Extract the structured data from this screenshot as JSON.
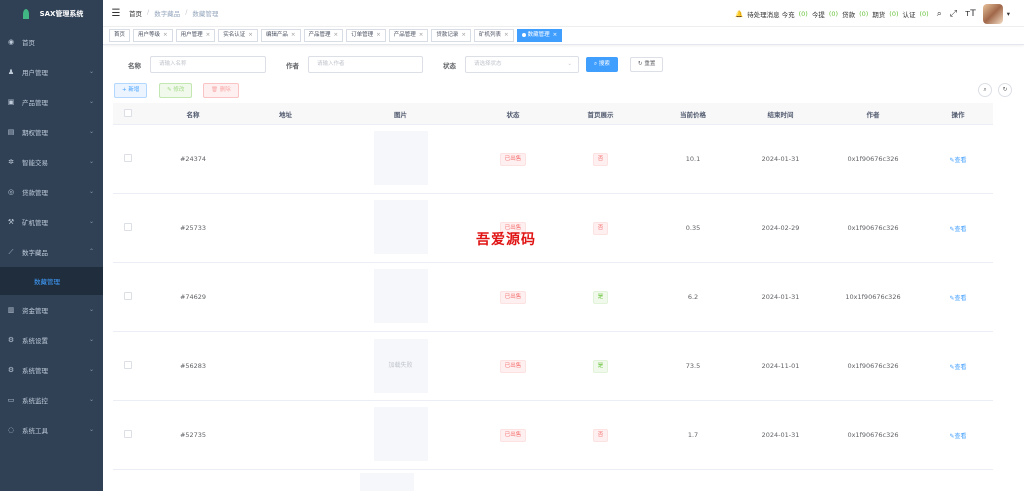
{
  "sidebar": {
    "logo": "SAX管理系统",
    "items": [
      {
        "label": "首页",
        "icon": "dashboard-icon",
        "glyph": "◉",
        "chevron": ""
      },
      {
        "label": "用户管理",
        "icon": "user-icon",
        "glyph": "♟",
        "chevron": "⌄"
      },
      {
        "label": "产品管理",
        "icon": "product-icon",
        "glyph": "▣",
        "chevron": "⌄"
      },
      {
        "label": "期权管理",
        "icon": "options-icon",
        "glyph": "▤",
        "chevron": "⌄"
      },
      {
        "label": "智能交易",
        "icon": "trade-icon",
        "glyph": "✲",
        "chevron": "⌄"
      },
      {
        "label": "贷款管理",
        "icon": "loan-icon",
        "glyph": "◎",
        "chevron": "⌄"
      },
      {
        "label": "矿机管理",
        "icon": "miner-icon",
        "glyph": "⚒",
        "chevron": "⌄"
      },
      {
        "label": "数字藏品",
        "icon": "nft-icon",
        "glyph": "⟋",
        "chevron": "⌃"
      },
      {
        "label": "数藏管理",
        "icon": "",
        "glyph": "",
        "chevron": ""
      },
      {
        "label": "资金管理",
        "icon": "funds-icon",
        "glyph": "▥",
        "chevron": "⌄"
      },
      {
        "label": "系统设置",
        "icon": "settings-icon",
        "glyph": "⚙",
        "chevron": "⌄"
      },
      {
        "label": "系统管理",
        "icon": "system-icon",
        "glyph": "⚙",
        "chevron": "⌄"
      },
      {
        "label": "系统监控",
        "icon": "monitor-icon",
        "glyph": "▭",
        "chevron": "⌄"
      },
      {
        "label": "系统工具",
        "icon": "tools-icon",
        "glyph": "◌",
        "chevron": "⌄"
      }
    ]
  },
  "navbar": {
    "breadcrumb": [
      "首页",
      "数字藏品",
      "数藏管理"
    ],
    "pending_label": "待处理消息 今充",
    "recharge_count": "(0)",
    "withdraw_label": "今提",
    "withdraw_count": "(0)",
    "loan_label": "贷款",
    "loan_count": "(0)",
    "futures_label": "期货",
    "futures_count": "(0)",
    "kyc_label": "认证",
    "kyc_count": "(0)"
  },
  "tags": [
    {
      "label": "首页",
      "active": false,
      "closable": false
    },
    {
      "label": "用户等级",
      "active": false,
      "closable": true
    },
    {
      "label": "用户管理",
      "active": false,
      "closable": true
    },
    {
      "label": "实名认证",
      "active": false,
      "closable": true
    },
    {
      "label": "编辑产品",
      "active": false,
      "closable": true
    },
    {
      "label": "产品管理",
      "active": false,
      "closable": true
    },
    {
      "label": "订单管理",
      "active": false,
      "closable": true
    },
    {
      "label": "产品管理",
      "active": false,
      "closable": true
    },
    {
      "label": "贷款记录",
      "active": false,
      "closable": true
    },
    {
      "label": "矿机列表",
      "active": false,
      "closable": true
    },
    {
      "label": "数藏管理",
      "active": true,
      "closable": true
    }
  ],
  "search": {
    "name_label": "名称",
    "name_placeholder": "请输入名称",
    "author_label": "作者",
    "author_placeholder": "请输入作者",
    "status_label": "状态",
    "status_placeholder": "请选择状态",
    "search_button": "搜索",
    "reset_button": "重置"
  },
  "toolbar": {
    "add": "新增",
    "edit": "修改",
    "delete": "删除"
  },
  "table": {
    "headers": [
      "名称",
      "地址",
      "图片",
      "状态",
      "首页展示",
      "当前价格",
      "结束时间",
      "作者",
      "操作"
    ],
    "rows": [
      {
        "name": "#24374",
        "address": "",
        "image": "",
        "status": "已出售",
        "home": "否",
        "home_color": "red",
        "price": "10.1",
        "end": "2024-01-31",
        "author": "0x1f90676c326",
        "action": "查看"
      },
      {
        "name": "#25733",
        "address": "",
        "image": "",
        "status": "已出售",
        "home": "否",
        "home_color": "red",
        "price": "0.35",
        "end": "2024-02-29",
        "author": "0x1f90676c326",
        "action": "查看"
      },
      {
        "name": "#74629",
        "address": "",
        "image": "",
        "status": "已出售",
        "home": "是",
        "home_color": "green",
        "price": "6.2",
        "end": "2024-01-31",
        "author": "10x1f90676c326",
        "action": "查看"
      },
      {
        "name": "#56283",
        "address": "",
        "image": "加载失败",
        "status": "已出售",
        "home": "是",
        "home_color": "green",
        "price": "73.5",
        "end": "2024-11-01",
        "author": "0x1f90676c326",
        "action": "查看"
      },
      {
        "name": "#52735",
        "address": "",
        "image": "",
        "status": "已出售",
        "home": "否",
        "home_color": "red",
        "price": "1.7",
        "end": "2024-01-31",
        "author": "0x1f90676c326",
        "action": "查看"
      }
    ]
  },
  "watermark": "吾爱源码",
  "colors": {
    "sidebar_bg": "#304156",
    "sidebar_active_sub": "#1f2d3d",
    "primary": "#409eff",
    "success": "#67c23a",
    "danger": "#f56c6c"
  }
}
